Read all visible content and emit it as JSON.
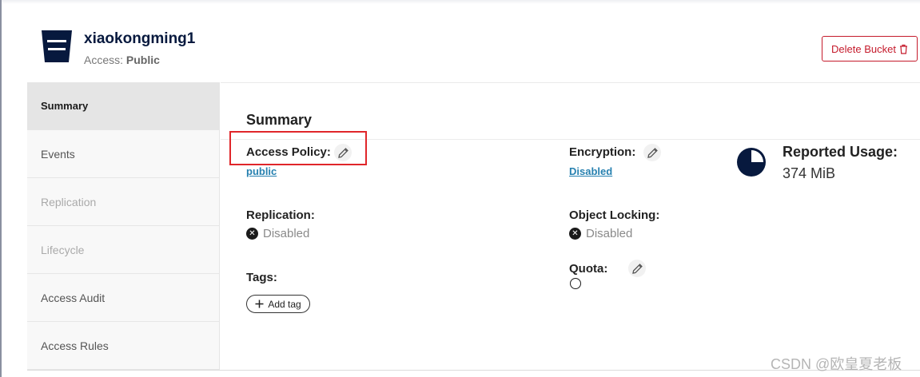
{
  "bucket": {
    "name": "xiaokongming1",
    "access_label": "Access:",
    "access_value": "Public",
    "delete_label": "Delete Bucket"
  },
  "sidebar": {
    "items": [
      {
        "label": "Summary",
        "state": "active"
      },
      {
        "label": "Events",
        "state": "normal"
      },
      {
        "label": "Replication",
        "state": "disabled"
      },
      {
        "label": "Lifecycle",
        "state": "disabled"
      },
      {
        "label": "Access Audit",
        "state": "normal"
      },
      {
        "label": "Access Rules",
        "state": "normal"
      }
    ]
  },
  "summary": {
    "title": "Summary",
    "access_policy": {
      "label": "Access Policy:",
      "value": "public"
    },
    "encryption": {
      "label": "Encryption:",
      "value": "Disabled"
    },
    "replication": {
      "label": "Replication:",
      "value": "Disabled"
    },
    "object_locking": {
      "label": "Object Locking:",
      "value": "Disabled"
    },
    "tags": {
      "label": "Tags:",
      "add_label": "Add tag"
    },
    "quota": {
      "label": "Quota:"
    },
    "usage": {
      "label": "Reported Usage:",
      "value": "374 MiB"
    }
  },
  "watermark": "CSDN @欧皇夏老板",
  "colors": {
    "brand_dark": "#07193e",
    "danger": "#c51b2c",
    "link": "#2781b0",
    "highlight_box": "#e0262a"
  },
  "icons": [
    "bucket-icon",
    "trash-icon",
    "pencil-icon",
    "x-circle-icon",
    "pie-chart-icon",
    "plus-icon",
    "circle-icon"
  ]
}
